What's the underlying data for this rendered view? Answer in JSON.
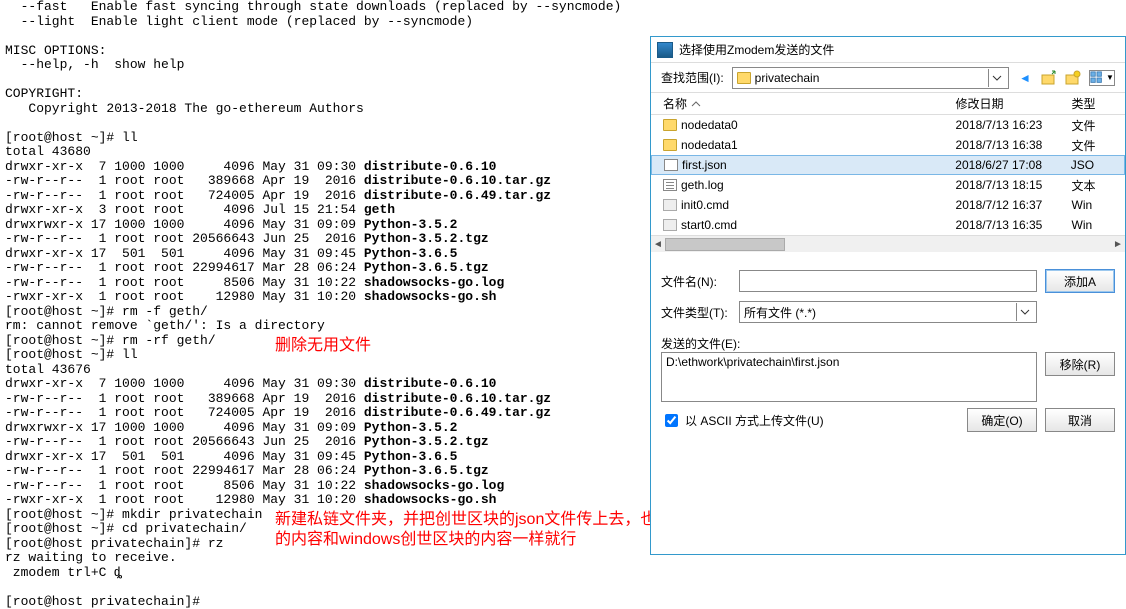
{
  "terminal": {
    "lines": [
      "  --fast   Enable fast syncing through state downloads (replaced by --syncmode)",
      "  --light  Enable light client mode (replaced by --syncmode)",
      "",
      "MISC OPTIONS:",
      "  --help, -h  show help",
      "",
      "COPYRIGHT:",
      "   Copyright 2013-2018 The go-ethereum Authors",
      "",
      "[root@host ~]# ll",
      "total 43680",
      "drwxr-xr-x  7 1000 1000     4096 May 31 09:30 distribute-0.6.10",
      "-rw-r--r--  1 root root   389668 Apr 19  2016 distribute-0.6.10.tar.gz",
      "-rw-r--r--  1 root root   724005 Apr 19  2016 distribute-0.6.49.tar.gz",
      "drwxr-xr-x  3 root root     4096 Jul 15 21:54 geth",
      "drwxrwxr-x 17 1000 1000     4096 May 31 09:09 Python-3.5.2",
      "-rw-r--r--  1 root root 20566643 Jun 25  2016 Python-3.5.2.tgz",
      "drwxr-xr-x 17  501  501     4096 May 31 09:45 Python-3.6.5",
      "-rw-r--r--  1 root root 22994617 Mar 28 06:24 Python-3.6.5.tgz",
      "-rw-r--r--  1 root root     8506 May 31 10:22 shadowsocks-go.log",
      "-rwxr-xr-x  1 root root    12980 May 31 10:20 shadowsocks-go.sh",
      "[root@host ~]# rm -f geth/",
      "rm: cannot remove `geth/': Is a directory",
      "[root@host ~]# rm -rf geth/",
      "[root@host ~]# ll",
      "total 43676",
      "drwxr-xr-x  7 1000 1000     4096 May 31 09:30 distribute-0.6.10",
      "-rw-r--r--  1 root root   389668 Apr 19  2016 distribute-0.6.10.tar.gz",
      "-rw-r--r--  1 root root   724005 Apr 19  2016 distribute-0.6.49.tar.gz",
      "drwxrwxr-x 17 1000 1000     4096 May 31 09:09 Python-3.5.2",
      "-rw-r--r--  1 root root 20566643 Jun 25  2016 Python-3.5.2.tgz",
      "drwxr-xr-x 17  501  501     4096 May 31 09:45 Python-3.6.5",
      "-rw-r--r--  1 root root 22994617 Mar 28 06:24 Python-3.6.5.tgz",
      "-rw-r--r--  1 root root     8506 May 31 10:22 shadowsocks-go.log",
      "-rwxr-xr-x  1 root root    12980 May 31 10:20 shadowsocks-go.sh",
      "[root@host ~]# mkdir privatechain",
      "[root@host ~]# cd privatechain/",
      "[root@host privatechain]# rz",
      "rz waiting to receive.",
      " zmodem trl+C ȡ",
      "",
      "[root@host privatechain]#"
    ],
    "bold_targets": [
      "distribute-0.6.10",
      "distribute-0.6.10.tar.gz",
      "distribute-0.6.49.tar.gz",
      "geth",
      "Python-3.5.2",
      "Python-3.5.2.tgz",
      "Python-3.6.5",
      "Python-3.6.5.tgz",
      "shadowsocks-go.log",
      "shadowsocks-go.sh"
    ],
    "annotation1": "删除无用文件",
    "annotation2_l1": "新建私链文件夹，并把创世区块的json文件传上去，也可以自己直接新建，反正保证里面",
    "annotation2_l2": "的内容和windows创世区块的内容一样就行"
  },
  "dialog": {
    "title": "选择使用Zmodem发送的文件",
    "lookin_label": "查找范围(I):",
    "lookin_value": "privatechain",
    "list_headers": {
      "name": "名称",
      "date": "修改日期",
      "type": "类型"
    },
    "files": [
      {
        "name": "nodedata0",
        "date": "2018/7/13 16:23",
        "type": "文件",
        "kind": "folder",
        "sel": false
      },
      {
        "name": "nodedata1",
        "date": "2018/7/13 16:38",
        "type": "文件",
        "kind": "folder",
        "sel": false
      },
      {
        "name": "first.json",
        "date": "2018/6/27 17:08",
        "type": "JSO",
        "kind": "json",
        "sel": true
      },
      {
        "name": "geth.log",
        "date": "2018/7/13 18:15",
        "type": "文本",
        "kind": "txt",
        "sel": false
      },
      {
        "name": "init0.cmd",
        "date": "2018/7/12 16:37",
        "type": "Win",
        "kind": "cmd",
        "sel": false
      },
      {
        "name": "start0.cmd",
        "date": "2018/7/13 16:35",
        "type": "Win",
        "kind": "cmd",
        "sel": false
      }
    ],
    "filename_label": "文件名(N):",
    "filename_value": "",
    "filetype_label": "文件类型(T):",
    "filetype_value": "所有文件 (*.*)",
    "sendfiles_label": "发送的文件(E):",
    "sendfiles_value": "D:\\ethwork\\privatechain\\first.json",
    "ascii_check": "以 ASCII 方式上传文件(U)",
    "btn_add": "添加A",
    "btn_remove": "移除(R)",
    "btn_ok": "确定(O)",
    "btn_cancel": "取消"
  }
}
